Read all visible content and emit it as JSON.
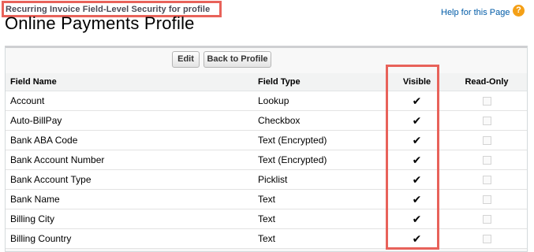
{
  "header": {
    "subtitle": "Recurring Invoice Field-Level Security for profile",
    "title": "Online Payments Profile",
    "help_link": "Help for this Page",
    "help_icon": "question-mark-icon"
  },
  "toolbar": {
    "edit_label": "Edit",
    "back_label": "Back to Profile"
  },
  "table": {
    "headers": {
      "field_name": "Field Name",
      "field_type": "Field Type",
      "visible": "Visible",
      "read_only": "Read-Only"
    },
    "rows": [
      {
        "name": "Account",
        "type": "Lookup",
        "visible": true,
        "read_only": false
      },
      {
        "name": "Auto-BillPay",
        "type": "Checkbox",
        "visible": true,
        "read_only": false
      },
      {
        "name": "Bank ABA Code",
        "type": "Text (Encrypted)",
        "visible": true,
        "read_only": false
      },
      {
        "name": "Bank Account Number",
        "type": "Text (Encrypted)",
        "visible": true,
        "read_only": false
      },
      {
        "name": "Bank Account Type",
        "type": "Picklist",
        "visible": true,
        "read_only": false
      },
      {
        "name": "Bank Name",
        "type": "Text",
        "visible": true,
        "read_only": false
      },
      {
        "name": "Billing City",
        "type": "Text",
        "visible": true,
        "read_only": false
      },
      {
        "name": "Billing Country",
        "type": "Text",
        "visible": true,
        "read_only": false
      }
    ]
  },
  "colors": {
    "highlight": "#e8625a",
    "link": "#015ba7",
    "help_icon": "#f4a017"
  }
}
